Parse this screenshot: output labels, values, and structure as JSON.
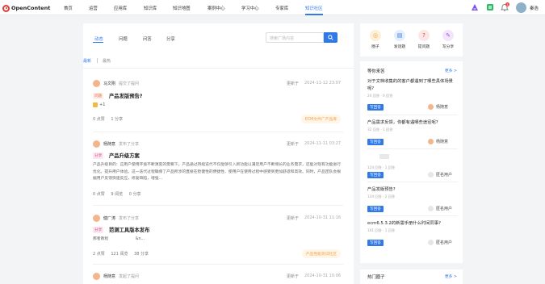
{
  "header": {
    "logo": "OpenContent",
    "nav": [
      "首页",
      "运营",
      "应用库",
      "知识库",
      "知识地图",
      "案例中心",
      "学习中心",
      "专家库",
      "知识社区"
    ],
    "active_nav": "知识社区",
    "notification_count": "1",
    "user_name": "秦浩"
  },
  "main": {
    "tabs": [
      "动态",
      "问题",
      "问答",
      "分享"
    ],
    "search_placeholder": "搜索广场内容",
    "sort": [
      "最新",
      "最热"
    ],
    "posts": [
      {
        "author": "马文刚",
        "action": "提交了提问",
        "updater": "更新于",
        "date": "2024-11-12 23:07",
        "tag": "问题",
        "title": "产品发版预告?",
        "extra": "+1",
        "likes": "0 点赞",
        "comments": "1 分享",
        "chip": "ECM文件广产品库"
      },
      {
        "author": "杨随意",
        "action": "发布了分享",
        "updater": "更新于",
        "date": "2024-11-11 03:27",
        "tag": "分享",
        "title": "产品升级方案",
        "body": "产品升级目的：应用户使用环境不断演变的需要下，产品通过持续迭代不仅能够引入新功能以满足用户不断增长的业务需求，还能对现有功能进行优化，提升用户体验。这一迭代过程确保了产品所涉的直接在稳健性的便捷性、使用户在使用过程中感受到更加舒适和高效。同时，产品团队会根据用户反馈快速反应，修复缺陷，增强...",
        "likes": "0 点赞",
        "views": "9 阅览",
        "shares": "0 分享"
      },
      {
        "author": "健厂涛",
        "action": "发布了分享",
        "updater": "更新于",
        "date": "2024-10-31 11:16",
        "tag": "分享",
        "title": "范测工具版本发布",
        "body": "那者教程                      &n...",
        "likes": "2 点赞",
        "views": "121 阅览",
        "shares": "38 分享",
        "chip": "产品性能测试社区"
      },
      {
        "author": "杨随意",
        "action": "发起了提问",
        "updater": "更新于",
        "date": "2024-10-31 10:06"
      }
    ]
  },
  "quick_actions": [
    "圈子",
    "发话题",
    "提问题",
    "写分享"
  ],
  "sidebar": {
    "title": "等你来答",
    "more": "更多 >",
    "questions": [
      {
        "text": "对于文档收集的的客户都遇到了哪些具体场景呢?",
        "meta": "24 回答 · 0 回答",
        "btn": "写回答",
        "user": "杨随意"
      },
      {
        "text": "产品需求反馈，你都有遇哪些途径呢?",
        "meta": "32 回答 · 1 回答",
        "btn": "写回答",
        "user": "杨随意"
      },
      {
        "text": "",
        "meta": "124 回答 · 1 回答",
        "btn": "写回答",
        "user": "匿名用户"
      },
      {
        "text": "产品发版预告?",
        "meta": "134 回答 · 2 回答",
        "btn": "写回答",
        "user": "匿名用户"
      },
      {
        "text": "ecm6.5.3.2的新需手册什么时间同事?",
        "meta": "101 回答 · 1 回答",
        "btn": "写回答",
        "user": "匿名用户"
      }
    ],
    "hot_title": "热门圈子",
    "hot_more": "更多 >"
  }
}
